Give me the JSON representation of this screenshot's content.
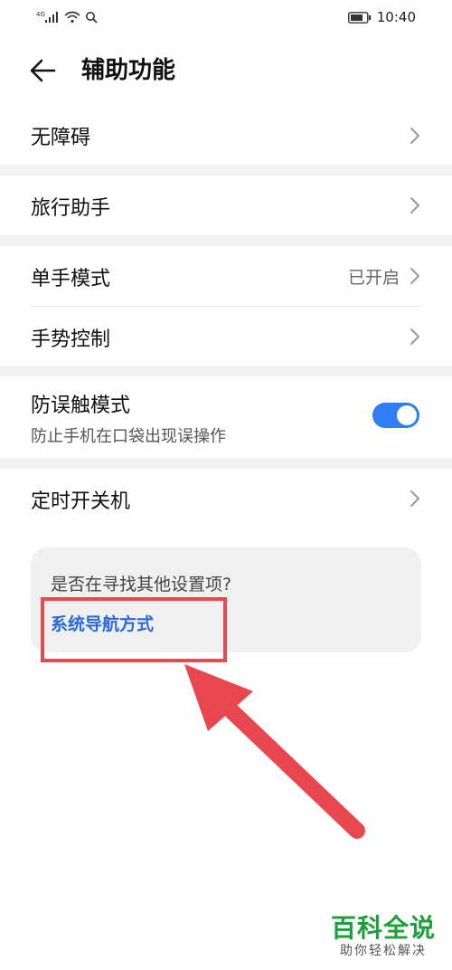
{
  "status_bar": {
    "network_label": "4G",
    "time": "10:40"
  },
  "header": {
    "title": "辅助功能"
  },
  "settings": {
    "accessibility": {
      "label": "无障碍"
    },
    "travel_assistant": {
      "label": "旅行助手"
    },
    "one_hand_mode": {
      "label": "单手模式",
      "value": "已开启"
    },
    "gesture_control": {
      "label": "手势控制"
    },
    "accidental_touch": {
      "label": "防误触模式",
      "description": "防止手机在口袋出现误操作",
      "enabled": true
    },
    "scheduled_power": {
      "label": "定时开关机"
    }
  },
  "suggestion": {
    "question": "是否在寻找其他设置项?",
    "link": "系统导航方式"
  },
  "colors": {
    "accent": "#2f7ef6",
    "link": "#2c6ad8",
    "annotation_red": "#e8474f",
    "watermark_green": "#1f9e3c"
  },
  "watermark": {
    "main": "百科全说",
    "sub": "助你轻松解决"
  }
}
